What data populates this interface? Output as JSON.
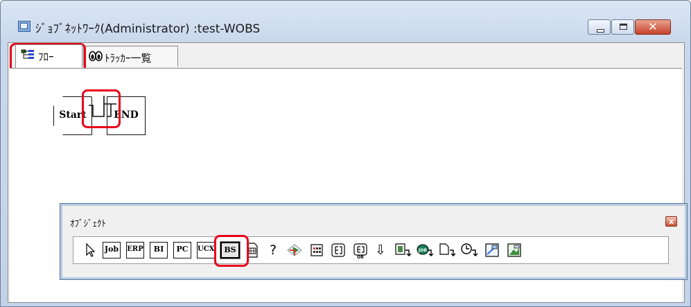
{
  "window": {
    "title": "ｼﾞｮﾌﾞﾈｯﾄﾜｰｸ(Administrator) :test-WOBS"
  },
  "tabs": [
    {
      "label": "ﾌﾛｰ",
      "icon": "flow-tree-icon"
    },
    {
      "label": "ﾄﾗｯｶｰ一覧",
      "icon": "binoculars-icon"
    }
  ],
  "flow": {
    "start_label": "Start",
    "end_label": "END"
  },
  "palette": {
    "title": "ｵﾌﾞｼﾞｪｸﾄ",
    "close_glyph": "x",
    "tools": [
      {
        "label": "",
        "icon": "arrow-cursor-icon"
      },
      {
        "label": "Job",
        "icon": "job-icon"
      },
      {
        "label": "ERP",
        "icon": "erp-icon"
      },
      {
        "label": "BI",
        "icon": "bi-icon"
      },
      {
        "label": "PC",
        "icon": "pc-icon"
      },
      {
        "label": "UCX",
        "icon": "ucx-icon"
      },
      {
        "label": "BS",
        "icon": "bs-icon",
        "selected": true
      },
      {
        "label": "",
        "icon": "document-icon"
      },
      {
        "label": "?",
        "icon": "question-icon"
      },
      {
        "label": "",
        "icon": "branch-arrow-icon"
      },
      {
        "label": "",
        "icon": "grid-table-icon"
      },
      {
        "label": "",
        "icon": "parallel-icon"
      },
      {
        "label": "",
        "icon": "or-parallel-icon"
      },
      {
        "label": "⇩",
        "icon": "down-arrow-icon"
      },
      {
        "label": "",
        "icon": "file-trigger-icon"
      },
      {
        "label": "",
        "icon": "event-trigger-icon"
      },
      {
        "label": "",
        "icon": "page-trigger-icon"
      },
      {
        "label": "",
        "icon": "clock-trigger-icon"
      },
      {
        "label": "",
        "icon": "custom-job-icon"
      },
      {
        "label": "",
        "icon": "picture-job-icon"
      }
    ]
  },
  "colors": {
    "highlight": "#e8001a",
    "titlebar": "#c9d8ec",
    "close_button": "#c8422a"
  }
}
